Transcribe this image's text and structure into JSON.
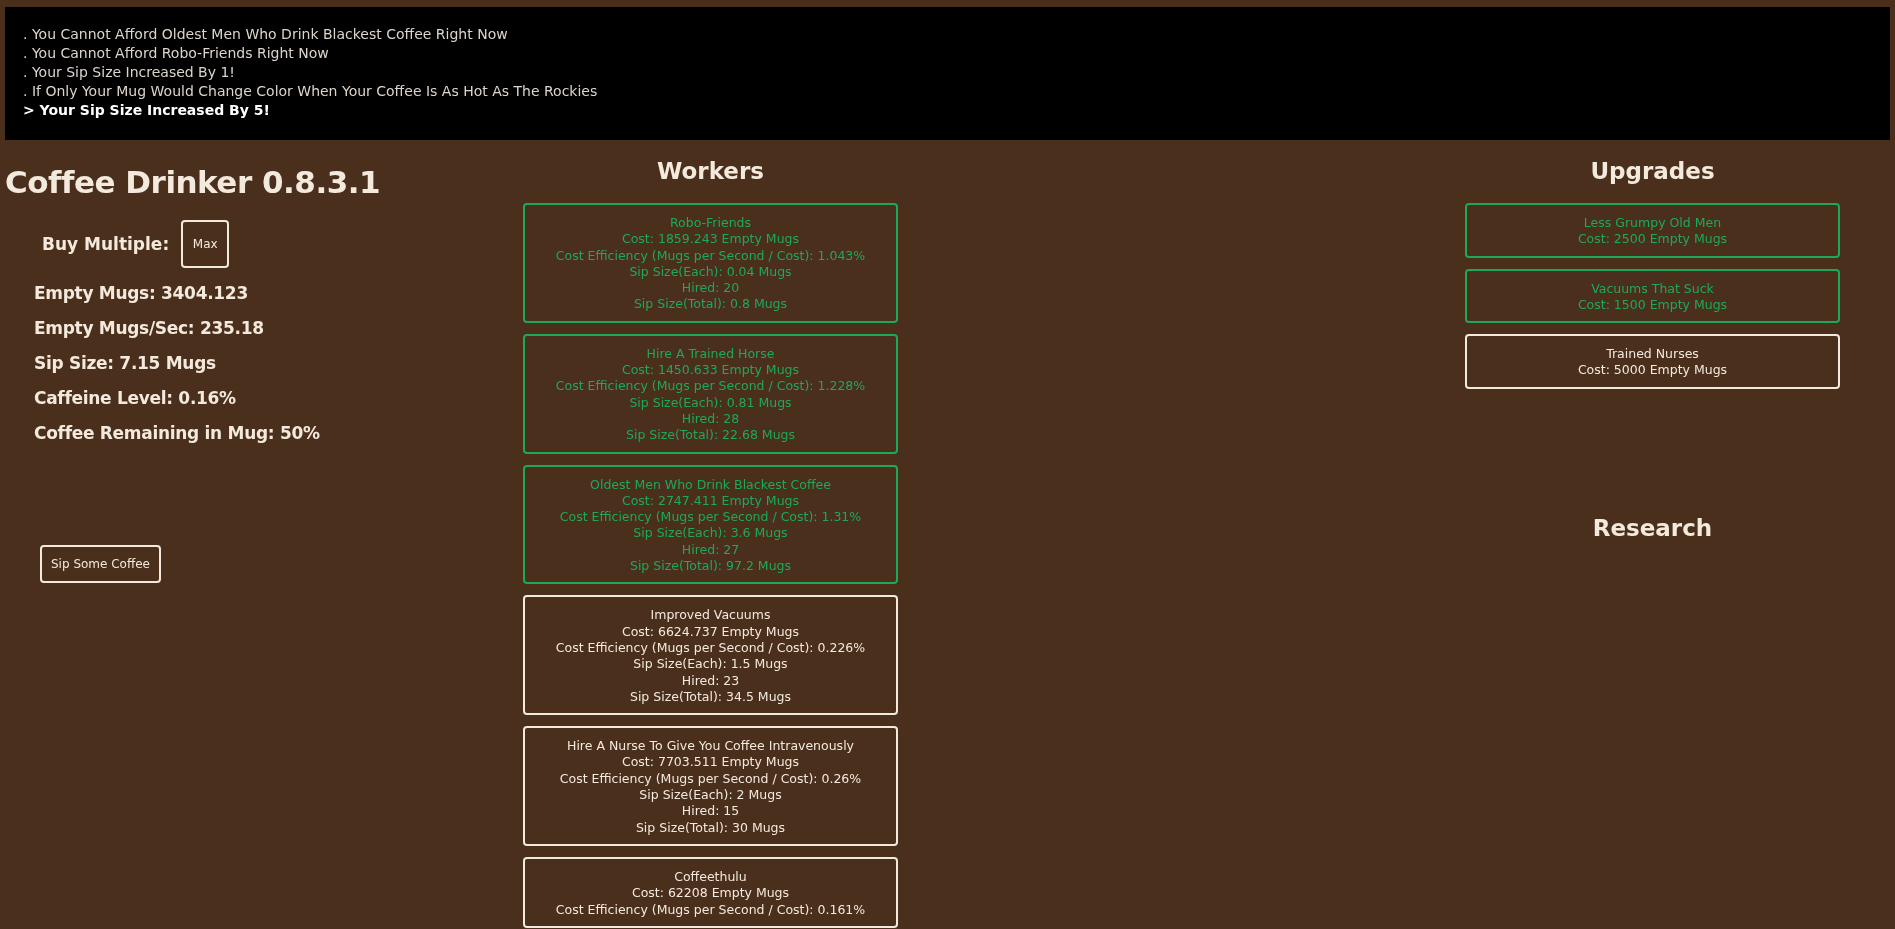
{
  "log": [
    {
      "kind": "past",
      "text": ". You Cannot Afford Oldest Men Who Drink Blackest Coffee Right Now"
    },
    {
      "kind": "past",
      "text": ". You Cannot Afford Robo-Friends Right Now"
    },
    {
      "kind": "past",
      "text": ". Your Sip Size Increased By 1!"
    },
    {
      "kind": "past",
      "text": ". If Only Your Mug Would Change Color When Your Coffee Is As Hot As The Rockies"
    },
    {
      "kind": "latest",
      "text": "> Your Sip Size Increased By 5!"
    }
  ],
  "title": "Coffee Drinker 0.8.3.1",
  "buy_multiple": {
    "label": "Buy Multiple:",
    "button": "Max"
  },
  "stats": [
    "Empty Mugs: 3404.123",
    "Empty Mugs/Sec: 235.18",
    "Sip Size: 7.15 Mugs",
    "Caffeine Level: 0.16%",
    "Coffee Remaining in Mug: 50%"
  ],
  "sip_button": "Sip Some Coffee",
  "workers": {
    "heading": "Workers",
    "items": [
      {
        "affordable": true,
        "lines": [
          "Robo-Friends",
          "Cost: 1859.243 Empty Mugs",
          "Cost Efficiency (Mugs per Second / Cost): 1.043%",
          "Sip Size(Each): 0.04 Mugs",
          "Hired: 20",
          "Sip Size(Total): 0.8 Mugs"
        ]
      },
      {
        "affordable": true,
        "lines": [
          "Hire A Trained Horse",
          "Cost: 1450.633 Empty Mugs",
          "Cost Efficiency (Mugs per Second / Cost): 1.228%",
          "Sip Size(Each): 0.81 Mugs",
          "Hired: 28",
          "Sip Size(Total): 22.68 Mugs"
        ]
      },
      {
        "affordable": true,
        "lines": [
          "Oldest Men Who Drink Blackest Coffee",
          "Cost: 2747.411 Empty Mugs",
          "Cost Efficiency (Mugs per Second / Cost): 1.31%",
          "Sip Size(Each): 3.6 Mugs",
          "Hired: 27",
          "Sip Size(Total): 97.2 Mugs"
        ]
      },
      {
        "affordable": false,
        "lines": [
          "Improved Vacuums",
          "Cost: 6624.737 Empty Mugs",
          "Cost Efficiency (Mugs per Second / Cost): 0.226%",
          "Sip Size(Each): 1.5 Mugs",
          "Hired: 23",
          "Sip Size(Total): 34.5 Mugs"
        ]
      },
      {
        "affordable": false,
        "lines": [
          "Hire A Nurse To Give You Coffee Intravenously",
          "Cost: 7703.511 Empty Mugs",
          "Cost Efficiency (Mugs per Second / Cost): 0.26%",
          "Sip Size(Each): 2 Mugs",
          "Hired: 15",
          "Sip Size(Total): 30 Mugs"
        ]
      },
      {
        "affordable": false,
        "lines": [
          "Coffeethulu",
          "Cost: 62208 Empty Mugs",
          "Cost Efficiency (Mugs per Second / Cost): 0.161%"
        ]
      }
    ]
  },
  "upgrades": {
    "heading": "Upgrades",
    "items": [
      {
        "affordable": true,
        "lines": [
          "Less Grumpy Old Men",
          "Cost: 2500 Empty Mugs"
        ]
      },
      {
        "affordable": true,
        "lines": [
          "Vacuums That Suck",
          "Cost: 1500 Empty Mugs"
        ]
      },
      {
        "affordable": false,
        "lines": [
          "Trained Nurses",
          "Cost: 5000 Empty Mugs"
        ]
      }
    ]
  },
  "research": {
    "heading": "Research"
  }
}
